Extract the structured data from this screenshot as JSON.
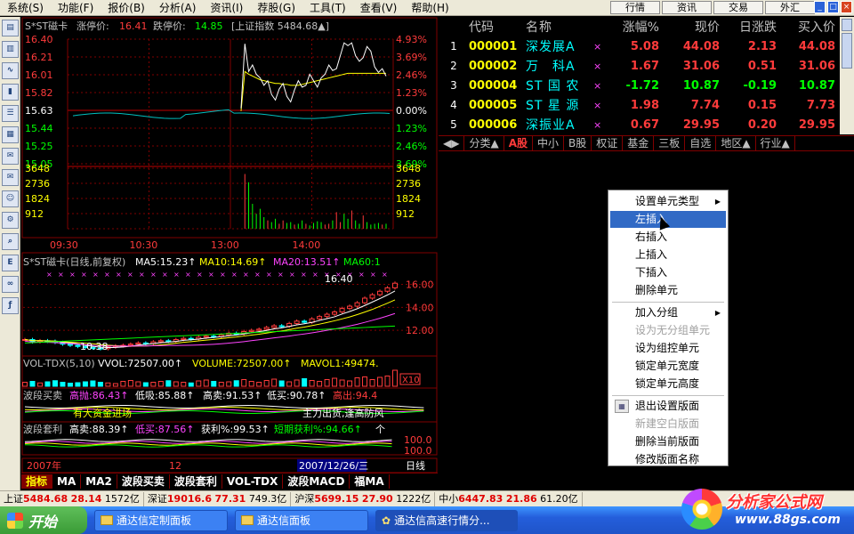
{
  "menu": [
    "系统(S)",
    "功能(F)",
    "报价(B)",
    "分析(A)",
    "资讯(I)",
    "荐股(G)",
    "工具(T)",
    "查看(V)",
    "帮助(H)"
  ],
  "top_buttons": [
    "行情",
    "资讯",
    "交易",
    "外汇"
  ],
  "window_controls": [
    "_",
    "□",
    "×"
  ],
  "left_tools": [
    "minute-chart-icon",
    "kline-icon",
    "trend-icon",
    "bar-chart-icon",
    "report-icon",
    "table-icon",
    "news-icon",
    "mail-icon",
    "people-icon",
    "finance-icon",
    "search-icon",
    "etf-icon",
    "link-icon",
    "formula-icon"
  ],
  "intraday": {
    "stock_label": "S*ST磁卡",
    "limit_up_label": "涨停价:",
    "limit_up": "16.41",
    "limit_down_label": "跌停价:",
    "limit_down": "14.85",
    "index_label": "[上证指数 5484.68▲]",
    "price_axis": [
      "16.40",
      "16.21",
      "16.01",
      "15.82",
      "15.63",
      "15.44",
      "15.25",
      "15.05"
    ],
    "pct_axis": [
      "4.93%",
      "3.69%",
      "2.46%",
      "1.23%",
      "0.00%",
      "1.23%",
      "2.46%",
      "3.69%"
    ],
    "volume_axis": [
      "3648",
      "2736",
      "1824",
      "912"
    ],
    "time_axis": [
      "09:30",
      "10:30",
      "13:00",
      "14:00"
    ],
    "price_range": [
      15.05,
      16.4
    ],
    "pre_close": 15.63,
    "price_series": [
      15.66,
      15.64,
      15.66,
      15.65,
      15.66,
      15.64,
      15.65,
      15.66,
      15.64,
      15.65,
      15.66,
      15.63,
      15.65,
      15.66,
      15.64,
      15.65,
      15.66,
      15.64,
      15.65,
      15.66,
      15.64,
      15.65,
      15.66,
      15.64,
      15.65,
      16.35,
      16.05,
      16.12,
      16.02,
      15.98,
      15.9,
      15.95,
      15.8,
      15.74,
      15.86,
      15.92,
      15.78,
      15.72,
      15.85,
      15.95,
      15.88,
      15.9,
      16.02,
      15.95,
      15.88,
      15.98,
      16.02,
      16.12,
      16.06,
      16.08,
      16.22,
      16.36,
      16.33,
      16.36,
      16.22,
      16.16,
      16.2,
      16.32,
      16.27,
      16.1,
      16.04,
      16.08,
      16.0
    ],
    "avg_series": [
      15.62,
      15.62,
      15.62,
      15.62,
      15.62,
      15.62,
      15.62,
      15.62,
      15.62,
      15.62,
      15.62,
      15.62,
      15.62,
      15.62,
      15.62,
      15.62,
      15.62,
      15.62,
      15.62,
      15.62,
      15.62,
      15.62,
      15.62,
      15.62,
      15.62,
      16.05,
      16.02,
      16.0,
      15.98,
      15.96,
      15.95,
      15.94,
      15.93,
      15.92,
      15.92,
      15.91,
      15.91,
      15.9,
      15.9,
      15.9,
      15.91,
      15.92,
      15.93,
      15.94,
      15.95,
      15.96,
      15.97,
      15.98,
      15.99,
      16.0,
      16.01,
      16.02,
      16.03,
      16.03,
      16.03,
      16.03,
      16.03,
      16.03,
      16.03,
      16.03,
      16.03,
      16.03,
      16.03
    ],
    "volume_series": [
      0,
      0,
      0,
      0,
      0,
      0,
      0,
      0,
      0,
      0,
      0,
      0,
      0,
      0,
      0,
      0,
      0,
      0,
      0,
      0,
      0,
      0,
      0,
      0,
      0,
      3300,
      2800,
      1500,
      900,
      1200,
      700,
      500,
      400,
      600,
      300,
      500,
      350,
      400,
      250,
      300,
      500,
      300,
      200,
      350,
      450,
      400,
      250,
      300,
      500,
      1000,
      400,
      900,
      600,
      1100,
      500,
      300,
      800,
      400,
      250,
      300,
      350,
      250,
      300
    ]
  },
  "kline": {
    "title": "S*ST磁卡(日线,前复权)",
    "ma5_label": "MA5:15.23↑",
    "ma10_label": "MA10:14.69↑",
    "ma20_label": "MA20:13.51↑",
    "ma60_label": "MA60:1",
    "price_axis": [
      "16.00",
      "14.00",
      "12.00"
    ],
    "high_label": "16.40",
    "low_label": "10.38",
    "price_range": [
      10.0,
      17.2
    ],
    "closes": [
      11.2,
      11.0,
      11.1,
      11.05,
      10.95,
      10.8,
      10.7,
      10.6,
      10.5,
      10.45,
      10.4,
      10.55,
      10.65,
      10.7,
      10.8,
      10.9,
      10.85,
      11.0,
      11.1,
      11.05,
      11.2,
      11.3,
      11.25,
      11.4,
      11.5,
      11.45,
      11.6,
      11.75,
      11.7,
      11.9,
      12.0,
      12.1,
      12.25,
      12.4,
      12.35,
      12.6,
      12.8,
      12.7,
      13.0,
      13.2,
      13.4,
      13.6,
      13.9,
      14.1,
      14.4,
      14.8,
      15.1,
      15.4,
      15.7,
      16.1
    ]
  },
  "vol_tdx": {
    "title": "VOL-TDX(5,10)",
    "vvol_label": "VVOL:72507.00↑",
    "volume_label": "VOLUME:72507.00↑",
    "mavol_label": "MAVOL1:49474.",
    "scale_label": "X10",
    "values": [
      18,
      22,
      15,
      20,
      25,
      18,
      14,
      16,
      20,
      24,
      18,
      15,
      12,
      22,
      26,
      20,
      16,
      18,
      22,
      25,
      20,
      18,
      15,
      24,
      28,
      22,
      18,
      20,
      25,
      30,
      22,
      18,
      26,
      32,
      24,
      20,
      28,
      34,
      26,
      22,
      30,
      36,
      28,
      24,
      38,
      42,
      30,
      40,
      46,
      72
    ]
  },
  "wave_buy": {
    "title": "波段买卖",
    "high_label": "高抛:86.43↑",
    "low_label": "低吸:85.88↑",
    "sell_label": "高卖:91.53↑",
    "buy_label": "低买:90.78↑",
    "out_label": "高出:94.4",
    "note_left": "有大资金进场",
    "note_right": "主力出货,逢高防风"
  },
  "wave_arb": {
    "title": "波段套利",
    "sell_label": "高卖:88.39↑",
    "low_label": "低买:87.56↑",
    "profit_label": "获利%:99.53↑",
    "short_label": "短期获利%:94.66↑",
    "tail_label": "个",
    "axis": [
      "100.0",
      "100.0"
    ]
  },
  "kline_time": {
    "year": "2007年",
    "month": "12",
    "date": "2007/12/26/三",
    "period": "日线"
  },
  "indicator_tabs": [
    "指标",
    "MA",
    "MA2",
    "波段买卖",
    "波段套利",
    "VOL-TDX",
    "波段MACD",
    "福MA"
  ],
  "quote": {
    "headers": [
      "",
      "代码",
      "名称",
      "",
      "涨幅%",
      "现价",
      "日涨跌",
      "买入价"
    ],
    "rows": [
      {
        "n": "1",
        "code": "000001",
        "name": "深发展A",
        "x": "×",
        "pct": "5.08",
        "price": "44.08",
        "chg": "2.13",
        "buy": "44.08",
        "dir": "up"
      },
      {
        "n": "2",
        "code": "000002",
        "name": "万　科A",
        "x": "×",
        "pct": "1.67",
        "price": "31.06",
        "chg": "0.51",
        "buy": "31.06",
        "dir": "up"
      },
      {
        "n": "3",
        "code": "000004",
        "name": "ST 国 农",
        "x": "×",
        "pct": "-1.72",
        "price": "10.87",
        "chg": "-0.19",
        "buy": "10.87",
        "dir": "dn"
      },
      {
        "n": "4",
        "code": "000005",
        "name": "ST 星 源",
        "x": "×",
        "pct": "1.98",
        "price": "7.74",
        "chg": "0.15",
        "buy": "7.73",
        "dir": "up"
      },
      {
        "n": "5",
        "code": "000006",
        "name": "深振业A",
        "x": "×",
        "pct": "0.67",
        "price": "29.95",
        "chg": "0.20",
        "buy": "29.95",
        "dir": "up"
      }
    ]
  },
  "category_tabs": [
    "◀▶",
    "分类▲",
    "A股",
    "中小",
    "B股",
    "权证",
    "基金",
    "三板",
    "自选",
    "地区▲",
    "行业▲"
  ],
  "context_menu": [
    {
      "label": "设置单元类型",
      "arrow": "▶"
    },
    {
      "label": "左插入",
      "highlight": true
    },
    {
      "label": "右插入"
    },
    {
      "label": "上插入"
    },
    {
      "label": "下插入"
    },
    {
      "label": "删除单元"
    },
    {
      "sep": true
    },
    {
      "label": "加入分组",
      "arrow": "▶"
    },
    {
      "label": "设为无分组单元",
      "disabled": true
    },
    {
      "label": "设为组控单元"
    },
    {
      "label": "锁定单元宽度"
    },
    {
      "label": "锁定单元高度"
    },
    {
      "sep": true
    },
    {
      "label": "退出设置版面",
      "icon": "layout-icon"
    },
    {
      "label": "新建空白版面",
      "disabled": true
    },
    {
      "label": "删除当前版面"
    },
    {
      "label": "修改版面名称"
    }
  ],
  "statusbar": [
    {
      "name": "上证",
      "value": "5484.68",
      "chg": "28.14",
      "amt": "1572亿",
      "dir": "up"
    },
    {
      "name": "深证",
      "value": "19016.6",
      "chg": "77.31",
      "amt": "749.3亿",
      "dir": "up"
    },
    {
      "name": "沪深",
      "value": "5699.15",
      "chg": "27.90",
      "amt": "1222亿",
      "dir": "up"
    },
    {
      "name": "中小",
      "value": "6447.83",
      "chg": "21.86",
      "amt": "61.20亿",
      "dir": "up"
    }
  ],
  "taskbar": {
    "start": "开始",
    "items": [
      "通达信定制面板",
      "通达信面板",
      "通达信高速行情分..."
    ]
  },
  "watermark": {
    "title": "分析家公式网",
    "url": "www.88gs.com"
  },
  "colors": {
    "up": "#ff3b3b",
    "down": "#00ff00",
    "price_line": "#ffffff",
    "avg_line": "#ffff00",
    "grid": "#800000"
  }
}
